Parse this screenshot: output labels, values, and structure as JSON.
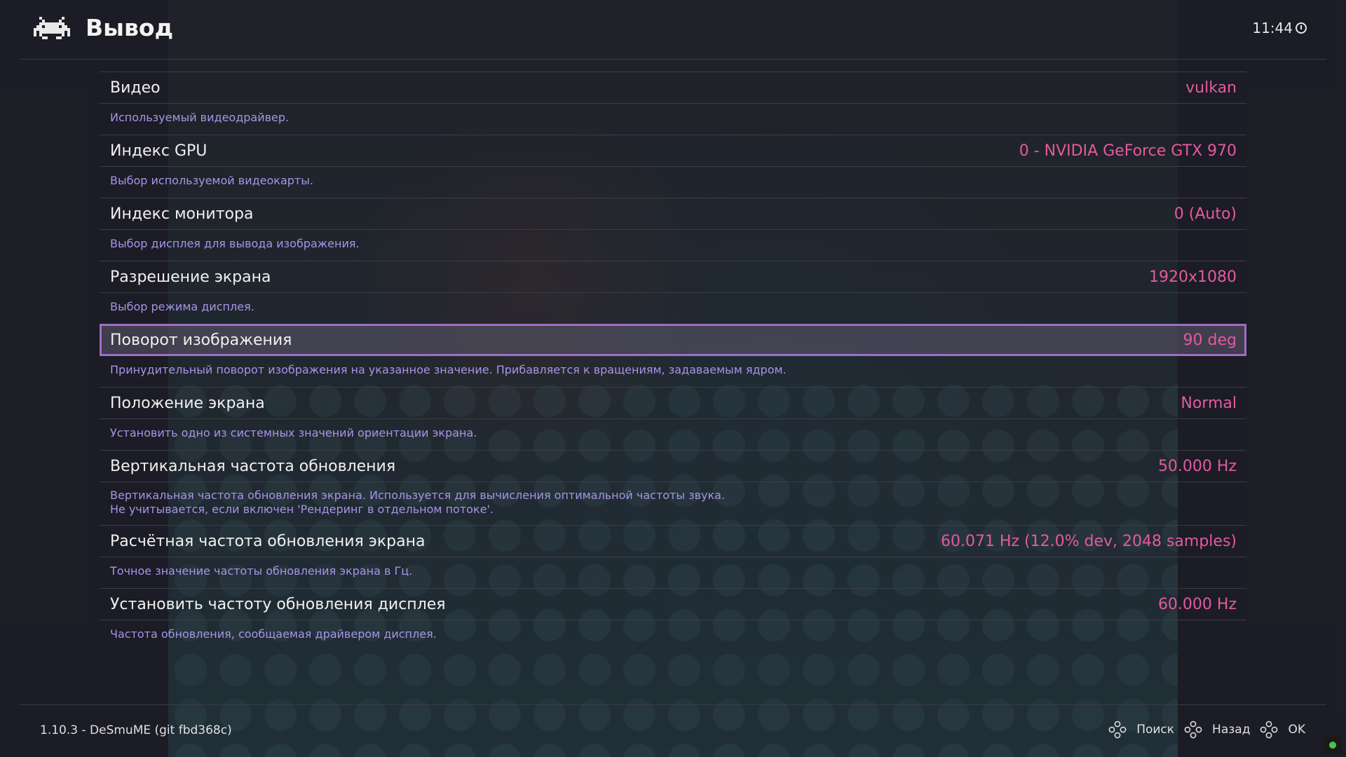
{
  "header": {
    "title": "Вывод",
    "clock": "11:44",
    "logo_icon": "retroarch-invader-icon",
    "clock_icon": "clock-icon"
  },
  "colors": {
    "value": "#e35aa0",
    "description": "#a794e6",
    "selection_border": "#9b6fc7"
  },
  "settings": [
    {
      "label": "Видео",
      "value": "vulkan",
      "desc": [
        "Используемый видеодрайвер."
      ]
    },
    {
      "label": "Индекс GPU",
      "value": "0 - NVIDIA GeForce GTX 970",
      "desc": [
        "Выбор используемой видеокарты."
      ]
    },
    {
      "label": "Индекс монитора",
      "value": "0 (Auto)",
      "desc": [
        "Выбор дисплея для вывода изображения."
      ]
    },
    {
      "label": "Разрешение экрана",
      "value": "1920x1080",
      "desc": [
        "Выбор режима дисплея."
      ]
    },
    {
      "label": "Поворот изображения",
      "value": "90 deg",
      "selected": true,
      "desc": [
        "Принудительный поворот изображения на указанное значение. Прибавляется к вращениям, задаваемым ядром."
      ]
    },
    {
      "label": "Положение экрана",
      "value": "Normal",
      "desc": [
        "Установить одно из системных значений ориентации экрана."
      ]
    },
    {
      "label": "Вертикальная частота обновления",
      "value": "50.000 Hz",
      "desc": [
        "Вертикальная частота обновления экрана. Используется для вычисления оптимальной частоты звука.",
        "Не учитывается, если включен 'Рендеринг в отдельном потоке'."
      ]
    },
    {
      "label": "Расчётная частота обновления экрана",
      "value": "60.071 Hz (12.0% dev, 2048 samples)",
      "desc": [
        "Точное значение частоты обновления экрана в Гц."
      ]
    },
    {
      "label": "Установить частоту обновления дисплея",
      "value": "60.000 Hz",
      "desc": [
        "Частота обновления, сообщаемая драйвером дисплея."
      ]
    }
  ],
  "footer": {
    "version": "1.10.3 - DeSmuME (git fbd368c)",
    "hints": [
      {
        "label": "Поиск",
        "icon": "gamepad-buttons-icon"
      },
      {
        "label": "Назад",
        "icon": "gamepad-buttons-icon"
      },
      {
        "label": "OK",
        "icon": "gamepad-buttons-icon"
      }
    ]
  }
}
